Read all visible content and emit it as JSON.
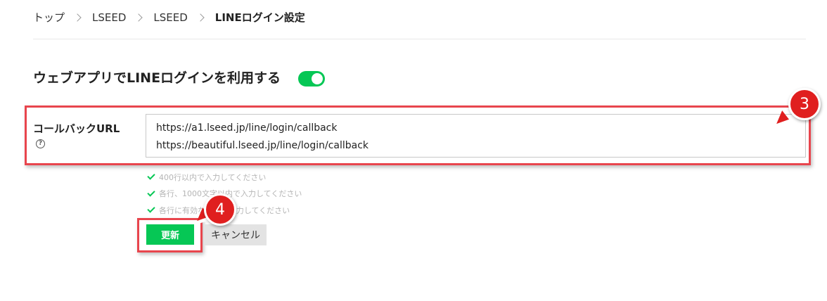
{
  "breadcrumb": {
    "items": [
      "トップ",
      "LSEED",
      "LSEED"
    ],
    "current": "LINEログイン設定"
  },
  "section": {
    "title": "ウェブアプリでLINEログインを利用する",
    "toggle_on": true
  },
  "callback": {
    "label": "コールバックURL",
    "help_icon": "question-circle-icon",
    "urls": [
      "https://a1.lseed.jp/line/login/callback",
      "https://beautiful.lseed.jp/line/login/callback"
    ]
  },
  "hints": [
    "400行以内で入力してください",
    "各行、1000文字以内で入力してください",
    "各行に有効なURLを入力してください"
  ],
  "buttons": {
    "update": "更新",
    "cancel": "キャンセル"
  },
  "annotations": {
    "step3": "3",
    "step4": "4"
  },
  "colors": {
    "accent": "#06c755",
    "annotation": "#e01f1f",
    "highlight_border": "#e8454d"
  }
}
